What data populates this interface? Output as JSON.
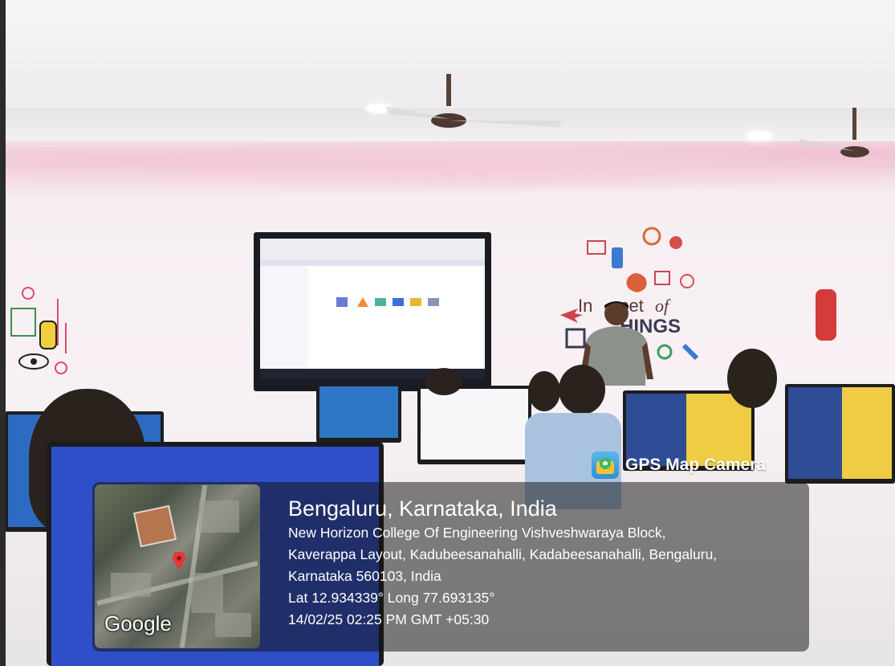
{
  "overlay": {
    "app_name": "GPS Map Camera",
    "map_brand": "Google",
    "location_title": "Bengaluru, Karnataka, India",
    "address_line_1": "New Horizon College Of Engineering Vishveshwaraya Block,",
    "address_line_2": "Kaverappa Layout, Kadubeesanahalli, Kadabeesanahalli, Bengaluru,",
    "address_line_3": "Karnataka 560103, India",
    "coordinates": "Lat 12.934339° Long 77.693135°",
    "datetime": "14/02/25 02:25 PM GMT +05:30"
  },
  "scene": {
    "wall_art_text": "Internet of THINGS",
    "colors": {
      "wall_pink": "#f3c6d6",
      "pin_red": "#e53935",
      "extinguisher": "#d43b3b"
    }
  }
}
